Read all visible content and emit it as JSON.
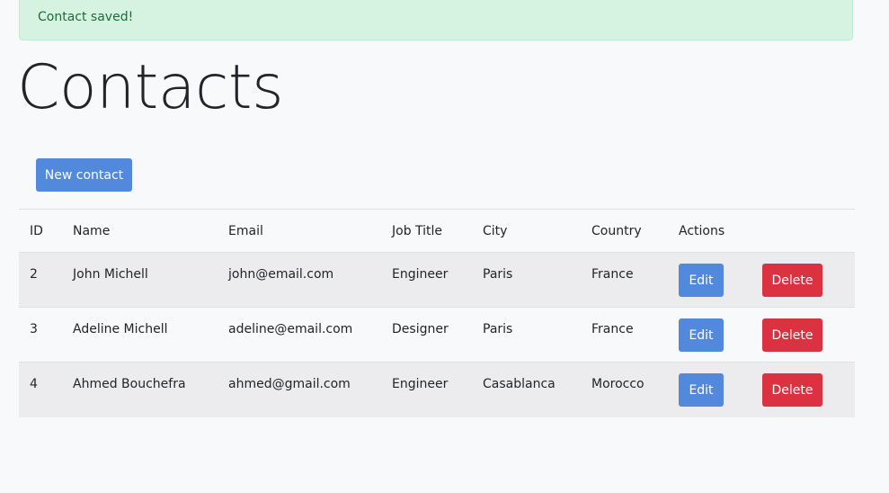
{
  "alert": {
    "message": "Contact saved!"
  },
  "page": {
    "title": "Contacts"
  },
  "toolbar": {
    "new_contact_label": "New contact"
  },
  "table": {
    "headers": [
      "ID",
      "Name",
      "Email",
      "Job Title",
      "City",
      "Country",
      "Actions"
    ],
    "rows": [
      {
        "id": "2",
        "name": "John Michell",
        "email": "john@email.com",
        "job": "Engineer",
        "city": "Paris",
        "country": "France",
        "edit": "Edit",
        "delete": "Delete"
      },
      {
        "id": "3",
        "name": "Adeline Michell",
        "email": "adeline@email.com",
        "job": "Designer",
        "city": "Paris",
        "country": "France",
        "edit": "Edit",
        "delete": "Delete"
      },
      {
        "id": "4",
        "name": "Ahmed Bouchefra",
        "email": "ahmed@gmail.com",
        "job": "Engineer",
        "city": "Casablanca",
        "country": "Morocco",
        "edit": "Edit",
        "delete": "Delete"
      }
    ]
  },
  "colors": {
    "alert_bg": "#d6f3e1",
    "alert_text": "#1e6b3a",
    "primary": "#5289dd",
    "danger": "#dc3140",
    "stripe": "#ececee"
  }
}
